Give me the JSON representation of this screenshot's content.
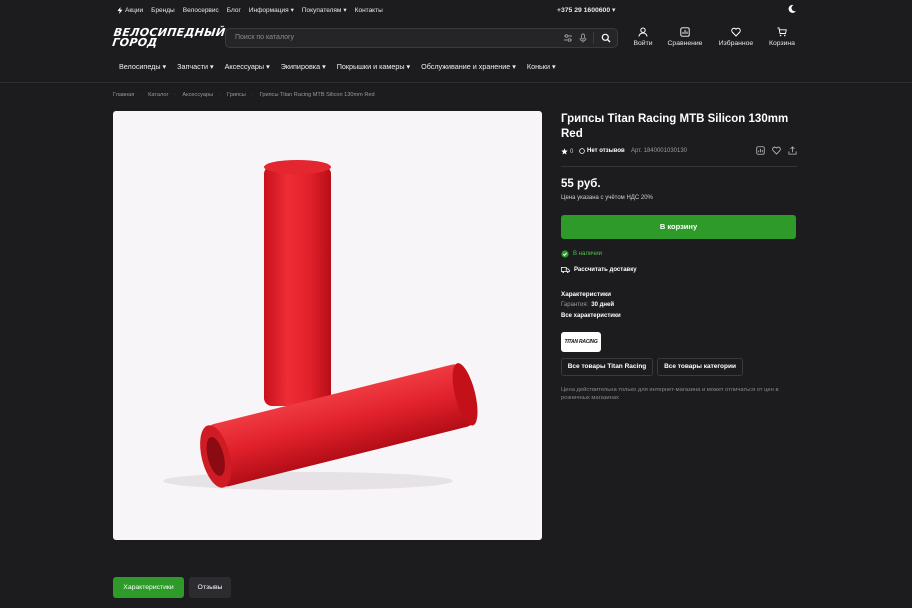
{
  "topbar": {
    "links": [
      {
        "label": "Акции",
        "icon": "lightning-icon"
      },
      {
        "label": "Бренды"
      },
      {
        "label": "Велосервис"
      },
      {
        "label": "Блог"
      },
      {
        "label": "Информация",
        "dropdown": true
      },
      {
        "label": "Покупателям",
        "dropdown": true
      },
      {
        "label": "Контакты"
      }
    ],
    "phone": "+375 29 1600600",
    "theme_icon": "moon-icon"
  },
  "logo": {
    "line1": "ВЕЛОСИПЕДНЫЙ",
    "line2": "ГОРОД"
  },
  "search": {
    "placeholder": "Поиск по каталогу"
  },
  "header_icons": [
    {
      "label": "Войти",
      "icon": "user-icon"
    },
    {
      "label": "Сравнение",
      "icon": "compare-icon"
    },
    {
      "label": "Избранное",
      "icon": "heart-icon"
    },
    {
      "label": "Корзина",
      "icon": "cart-icon"
    }
  ],
  "nav": [
    "Велосипеды",
    "Запчасти",
    "Аксессуары",
    "Экипировка",
    "Покрышки и камеры",
    "Обслуживание и хранение",
    "Коньки"
  ],
  "breadcrumbs": [
    "Главная",
    "Каталог",
    "Аксессуары",
    "Грипсы",
    "Грипсы Titan Racing MTB Silicon 130mm Red"
  ],
  "product": {
    "title": "Грипсы Titan Racing MTB Silicon 130mm Red",
    "rating": "0",
    "reviews": "Нет отзывов",
    "article": "Арт. 1840001030130",
    "price": "55 руб.",
    "vat_note": "Цена указана с учётом НДС 20%",
    "cart_button": "В корзину",
    "stock": "В наличии",
    "delivery": "Рассчитать доставку",
    "chars_title": "Характеристики",
    "warranty_label": "Гарантия:",
    "warranty_value": "30 дней",
    "all_chars": "Все характеристики",
    "brand_logo_text": "TITAN RACING",
    "brand_button": "Все товары Titan Racing",
    "category_button": "Все товары категории",
    "price_note": "Цена действительна только для интернет-магазина и может отличаться от цен в розничных магазинах"
  },
  "tabs": {
    "chars": "Характеристики",
    "reviews": "Отзывы"
  },
  "colors": {
    "accent": "#2e9a2a",
    "background": "#1c1c1e",
    "product": "#e8242f"
  }
}
